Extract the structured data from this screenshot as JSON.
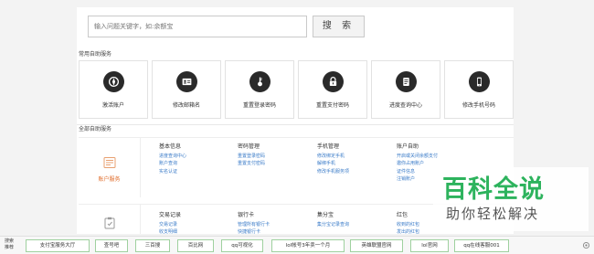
{
  "search": {
    "placeholder": "输入问题关键字，如:余额宝",
    "button_label": "搜 索"
  },
  "quick_services": {
    "title": "常用自助服务",
    "items": [
      {
        "label": "激活账户",
        "icon": "compass-icon"
      },
      {
        "label": "修改邮箱名",
        "icon": "id-card-icon"
      },
      {
        "label": "重置登录密码",
        "icon": "key-icon"
      },
      {
        "label": "重置支付密码",
        "icon": "lock-icon"
      },
      {
        "label": "进度查询中心",
        "icon": "document-icon"
      },
      {
        "label": "修改手机号码",
        "icon": "phone-icon"
      }
    ]
  },
  "all_services": {
    "title": "全部自助服务",
    "blocks": [
      {
        "caption": "账户服务",
        "columns": [
          {
            "header": "基本信息",
            "links": [
              "进度查询中心",
              "账户查询",
              "实名认证"
            ]
          },
          {
            "header": "密码管理",
            "links": [
              "重置登录密码",
              "重置支付密码"
            ]
          },
          {
            "header": "手机管理",
            "links": [
              "修改绑定手机",
              "解绑手机",
              "修改手机服务项"
            ]
          },
          {
            "header": "账户自助",
            "links": [
              "开启或关闭余额支付",
              "邀你占用账户",
              "证件信息",
              "注销账户"
            ]
          }
        ]
      },
      {
        "caption": "",
        "columns": [
          {
            "header": "交易记录",
            "links": [
              "交易记录",
              "收支明细"
            ]
          },
          {
            "header": "银行卡",
            "links": [
              "管理所有银行卡",
              "快捷银行卡"
            ]
          },
          {
            "header": "集分宝",
            "links": [
              "集分宝记录查询"
            ]
          },
          {
            "header": "红包",
            "links": [
              "收到的红包",
              "发出的红包"
            ]
          }
        ]
      }
    ]
  },
  "watermark": {
    "line1": "百科全说",
    "line2": "助你轻松解决"
  },
  "footer": {
    "label": "搜索推荐",
    "chips": [
      "支付宝服务大厅",
      "查号吧",
      "三百搜",
      "百比网",
      "qq可视化",
      "lol帐号3年卖一个月",
      "英雄联盟官网",
      "lol官网",
      "qq在线客服001"
    ]
  },
  "colors": {
    "link": "#3a7bc8",
    "accent_orange": "#e06c2a",
    "watermark_green": "#2db35d",
    "chip_border": "#9fd19f"
  }
}
